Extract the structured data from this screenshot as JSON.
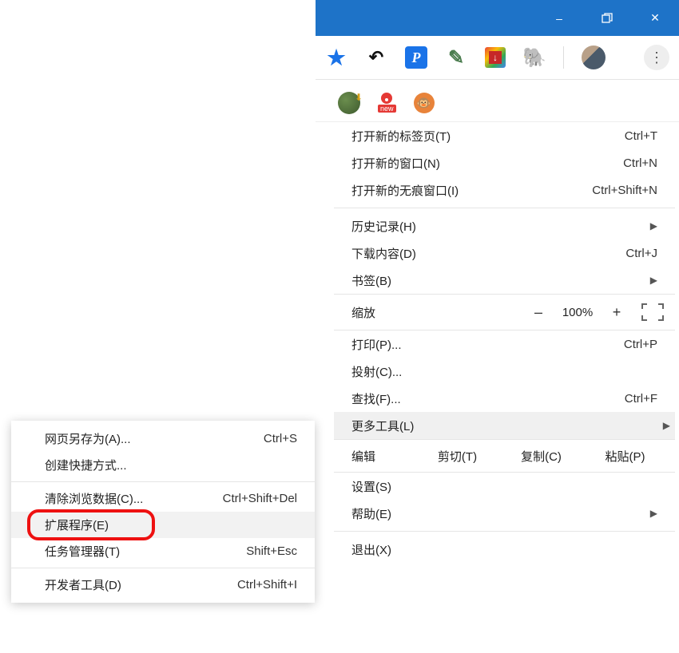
{
  "window": {
    "controls": {
      "minimize": "–",
      "maximize": "❐",
      "close": "✕"
    }
  },
  "ext_row": {
    "new_label": "new"
  },
  "menu": {
    "new_tab": {
      "label": "打开新的标签页(T)",
      "shortcut": "Ctrl+T"
    },
    "new_win": {
      "label": "打开新的窗口(N)",
      "shortcut": "Ctrl+N"
    },
    "incognito": {
      "label": "打开新的无痕窗口(I)",
      "shortcut": "Ctrl+Shift+N"
    },
    "history": {
      "label": "历史记录(H)"
    },
    "downloads": {
      "label": "下载内容(D)",
      "shortcut": "Ctrl+J"
    },
    "bookmarks": {
      "label": "书签(B)"
    },
    "zoom": {
      "label": "缩放",
      "value": "100%",
      "minus": "–",
      "plus": "+"
    },
    "print": {
      "label": "打印(P)...",
      "shortcut": "Ctrl+P"
    },
    "cast": {
      "label": "投射(C)..."
    },
    "find": {
      "label": "查找(F)...",
      "shortcut": "Ctrl+F"
    },
    "more_tools": {
      "label": "更多工具(L)"
    },
    "edit": {
      "label": "编辑",
      "cut": "剪切(T)",
      "copy": "复制(C)",
      "paste": "粘贴(P)"
    },
    "settings": {
      "label": "设置(S)"
    },
    "help": {
      "label": "帮助(E)"
    },
    "exit": {
      "label": "退出(X)"
    }
  },
  "submenu": {
    "save_as": {
      "label": "网页另存为(A)...",
      "shortcut": "Ctrl+S"
    },
    "shortcut": {
      "label": "创建快捷方式..."
    },
    "clear_data": {
      "label": "清除浏览数据(C)...",
      "shortcut": "Ctrl+Shift+Del"
    },
    "extensions": {
      "label": "扩展程序(E)"
    },
    "task_mgr": {
      "label": "任务管理器(T)",
      "shortcut": "Shift+Esc"
    },
    "dev_tools": {
      "label": "开发者工具(D)",
      "shortcut": "Ctrl+Shift+I"
    }
  }
}
